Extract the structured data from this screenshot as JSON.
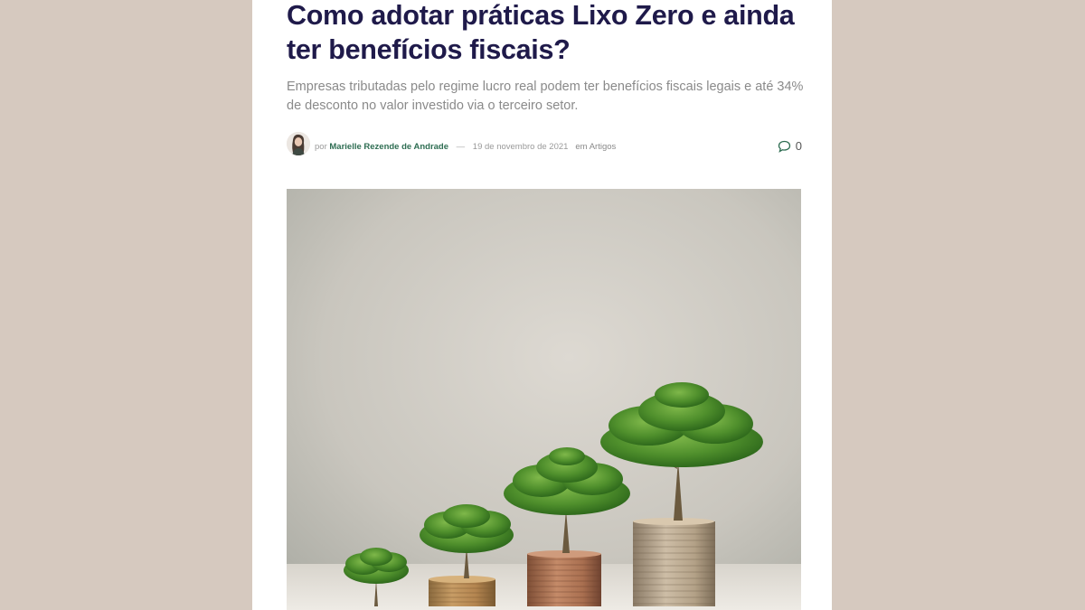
{
  "article": {
    "title": "Como adotar práticas Lixo Zero e ainda ter benefícios fiscais?",
    "subtitle": "Empresas tributadas pelo regime lucro real podem ter benefícios fiscais legais e até 34% de desconto no valor investido via o terceiro setor.",
    "meta": {
      "by_label": "por",
      "author": "Marielle Rezende de Andrade",
      "separator": "—",
      "date": "19 de novembro de 2021",
      "category_prefix": "em",
      "category": "Artigos",
      "comment_count": "0"
    },
    "hero_image": {
      "subject": "trees growing on stacks of coins",
      "icon": "growth-trees-coins-image"
    }
  },
  "colors": {
    "page_background": "#d6c9bf",
    "title": "#1f1a4a",
    "author": "#2f6e53",
    "subtitle": "#8a8a8a"
  }
}
